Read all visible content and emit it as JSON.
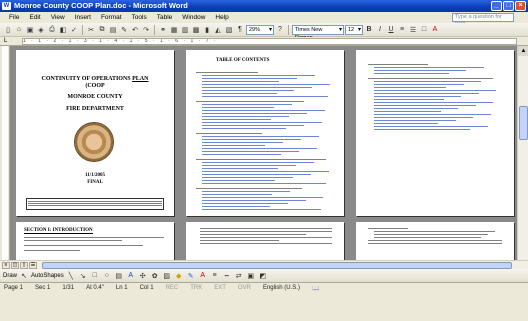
{
  "window": {
    "title": "Monroe County COOP Plan.doc - Microsoft Word",
    "icon": "word-icon"
  },
  "menus": [
    "File",
    "Edit",
    "View",
    "Insert",
    "Format",
    "Tools",
    "Table",
    "Window",
    "Help"
  ],
  "ask": {
    "placeholder": "Type a question for help"
  },
  "toolbar": {
    "zoom": "29%",
    "font": "Times New Roman",
    "size": "12"
  },
  "ruler": {
    "ticks": "1 · 1 · 2 · 1 · 3 · 1 · 4 · 1 · 5 · 1 · 6 · 1 · 7 ·"
  },
  "pages": {
    "cover": {
      "title_line1": "CONTINUITY OF OPERATIONS",
      "title_underlined": "PLAN",
      "title_line2": "(COOP",
      "county": "MONROE COUNTY",
      "department": "FIRE DEPARTMENT",
      "date": "11/1/2005",
      "status": "FINAL"
    },
    "toc": {
      "title": "TABLE OF CONTENTS"
    },
    "section1": {
      "title": "SECTION I: INTRODUCTION"
    }
  },
  "drawing": {
    "draw_label": "Draw",
    "autoshapes_label": "AutoShapes"
  },
  "status": {
    "page": "Page 1",
    "sec": "Sec 1",
    "pages": "1/31",
    "at": "At 0.4\"",
    "ln": "Ln 1",
    "col": "Col 1",
    "rec": "REC",
    "trk": "TRK",
    "ext": "EXT",
    "ovr": "OVR",
    "lang": "English (U.S.)"
  }
}
